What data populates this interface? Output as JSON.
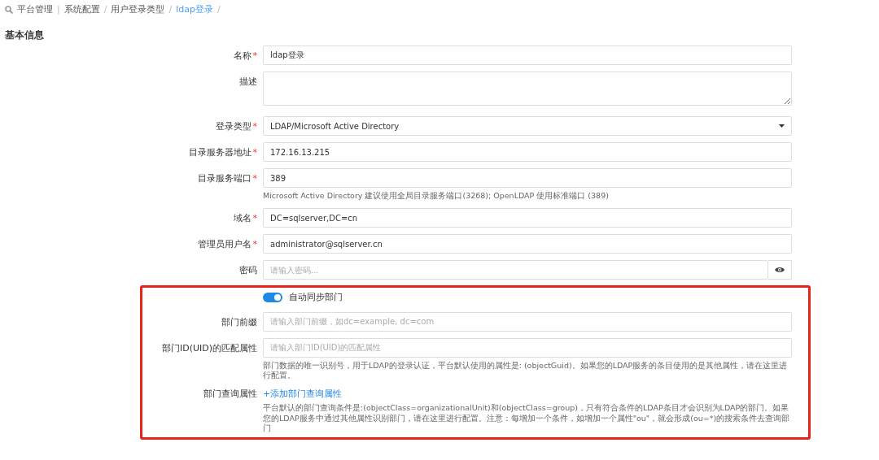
{
  "breadcrumb": [
    {
      "label": "平台管理",
      "current": false,
      "separator": "|"
    },
    {
      "label": "系统配置",
      "current": false,
      "separator": "/"
    },
    {
      "label": "用户登录类型",
      "current": false,
      "separator": "/"
    },
    {
      "label": "ldap登录",
      "current": true,
      "separator": "/"
    }
  ],
  "section_title": "基本信息",
  "fields": [
    {
      "kind": "text",
      "label": "名称",
      "required_mark": "*",
      "value": "ldap登录"
    },
    {
      "kind": "textarea",
      "label": "描述"
    },
    {
      "kind": "select",
      "label": "登录类型",
      "required_mark": "*",
      "value": "LDAP/Microsoft Active Directory"
    },
    {
      "kind": "text",
      "label": "目录服务器地址",
      "required_mark": "*",
      "value": "172.16.13.215"
    },
    {
      "kind": "text",
      "label": "目录服务端口",
      "required_mark": "*",
      "value": "389",
      "hint": "Microsoft Active Directory 建议使用全局目录服务端口(3268); OpenLDAP 使用标准端口 (389)"
    },
    {
      "kind": "text",
      "label": "域名",
      "required_mark": "*",
      "value": "DC=sqlserver,DC=cn"
    },
    {
      "kind": "text",
      "label": "管理员用户名",
      "required_mark": "*",
      "value": "administrator@sqlserver.cn"
    },
    {
      "kind": "password",
      "label": "密码",
      "placeholder": "请输入密码..."
    }
  ],
  "sync": {
    "annotation": {
      "kind": "frame"
    },
    "toggle": {
      "label": "自动同步部门",
      "on": true
    },
    "fields": [
      {
        "kind": "text",
        "label": "部门前缀",
        "placeholder": "请输入部门前缀，如dc=example, dc=com"
      },
      {
        "kind": "text",
        "label": "部门ID(UID)的匹配属性",
        "placeholder": "请输入部门ID(UID)的匹配属性",
        "hint": "部门数据的唯一识别号，用于LDAP的登录认证，平台默认使用的属性是: (objectGuid)。如果您的LDAP服务的条目使用的是其他属性，请在这里进行配置。"
      }
    ],
    "query": {
      "label": "部门查询属性",
      "link": "+添加部门查询属性",
      "hint": "平台默认的部门查询条件是:(objectClass=organizationalUnit)和(objectClass=group)，只有符合条件的LDAP条目才会识别为LDAP的部门。如果您的LDAP服务中通过其他属性识别部门，请在这里进行配置。注意：每增加一个条件，如增加一个属性\"ou\"，就会形成(ou=*)的搜索条件去查询部门"
    }
  }
}
